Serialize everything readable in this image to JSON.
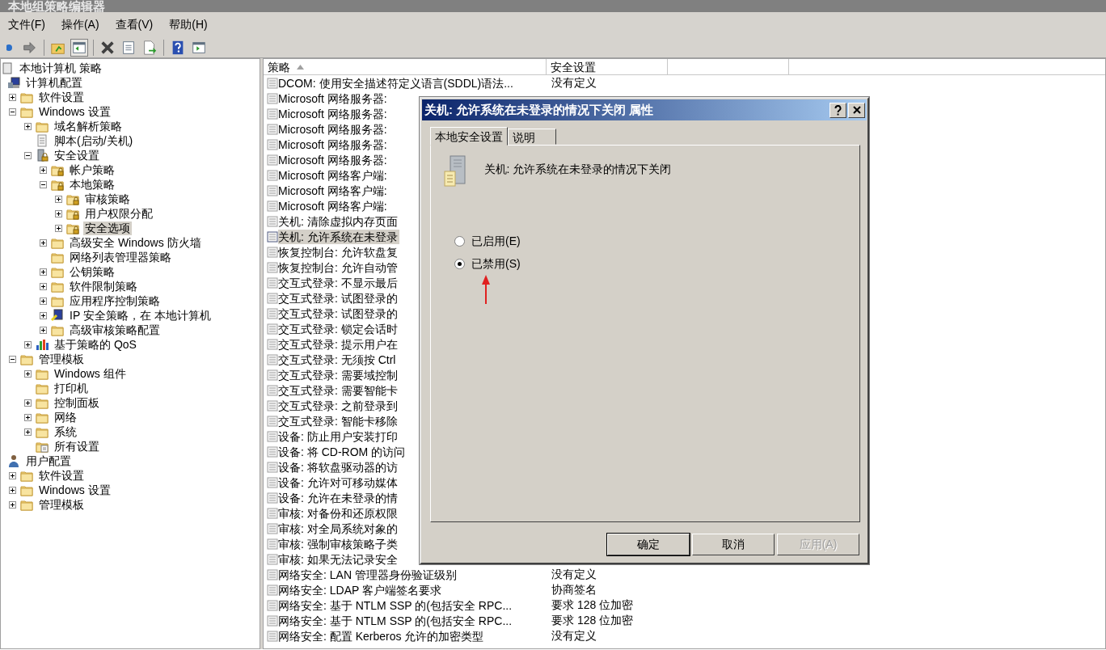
{
  "window": {
    "title": "本地组策略编辑器"
  },
  "menu": [
    "文件(F)",
    "操作(A)",
    "查看(V)",
    "帮助(H)"
  ],
  "toolbar": [
    {
      "kind": "back",
      "pressed": false
    },
    {
      "kind": "forward",
      "pressed": false
    },
    {
      "kind": "sep"
    },
    {
      "kind": "up",
      "pressed": false
    },
    {
      "kind": "tree",
      "pressed": true
    },
    {
      "kind": "sep"
    },
    {
      "kind": "delete",
      "pressed": false
    },
    {
      "kind": "properties",
      "pressed": false
    },
    {
      "kind": "export",
      "pressed": false
    },
    {
      "kind": "sep"
    },
    {
      "kind": "help",
      "pressed": false
    },
    {
      "kind": "pane",
      "pressed": false
    }
  ],
  "tree": [
    {
      "label": "本地计算机 策略",
      "kind": "policy",
      "selected": false,
      "children": [
        {
          "label": "计算机配置",
          "kind": "computer",
          "selected": false,
          "children": [
            {
              "label": "软件设置",
              "kind": "folder",
              "expanded": false,
              "selected": false
            },
            {
              "label": "Windows 设置",
              "kind": "folder",
              "expanded": true,
              "selected": false,
              "children": [
                {
                  "label": "域名解析策略",
                  "kind": "folder",
                  "expanded": false,
                  "selected": false
                },
                {
                  "label": "脚本(启动/关机)",
                  "kind": "script",
                  "selected": false
                },
                {
                  "label": "安全设置",
                  "kind": "server",
                  "expanded": true,
                  "selected": false,
                  "children": [
                    {
                      "label": "帐户策略",
                      "kind": "lockfolder",
                      "expanded": false,
                      "selected": false
                    },
                    {
                      "label": "本地策略",
                      "kind": "lockfolder",
                      "expanded": true,
                      "selected": false,
                      "children": [
                        {
                          "label": "审核策略",
                          "kind": "lockfolder",
                          "expanded": false,
                          "selected": false
                        },
                        {
                          "label": "用户权限分配",
                          "kind": "lockfolder",
                          "expanded": false,
                          "selected": false
                        },
                        {
                          "label": "安全选项",
                          "kind": "lockfolder",
                          "expanded": false,
                          "selected": true
                        }
                      ]
                    },
                    {
                      "label": "高级安全 Windows 防火墙",
                      "kind": "folder",
                      "expanded": false,
                      "selected": false
                    },
                    {
                      "label": "网络列表管理器策略",
                      "kind": "folder",
                      "selected": false
                    },
                    {
                      "label": "公钥策略",
                      "kind": "folder",
                      "expanded": false,
                      "selected": false
                    },
                    {
                      "label": "软件限制策略",
                      "kind": "folder",
                      "expanded": false,
                      "selected": false
                    },
                    {
                      "label": "应用程序控制策略",
                      "kind": "folder",
                      "expanded": false,
                      "selected": false
                    },
                    {
                      "label": "IP 安全策略，在 本地计算机",
                      "kind": "ipsec",
                      "expanded": false,
                      "selected": false
                    },
                    {
                      "label": "高级审核策略配置",
                      "kind": "folder",
                      "expanded": false,
                      "selected": false
                    }
                  ]
                },
                {
                  "label": "基于策略的 QoS",
                  "kind": "chart",
                  "expanded": false,
                  "selected": false
                }
              ]
            },
            {
              "label": "管理模板",
              "kind": "folder",
              "expanded": true,
              "selected": false,
              "children": [
                {
                  "label": "Windows 组件",
                  "kind": "folder",
                  "expanded": false,
                  "selected": false
                },
                {
                  "label": "打印机",
                  "kind": "folder",
                  "selected": false
                },
                {
                  "label": "控制面板",
                  "kind": "folder",
                  "expanded": false,
                  "selected": false
                },
                {
                  "label": "网络",
                  "kind": "folder",
                  "expanded": false,
                  "selected": false
                },
                {
                  "label": "系统",
                  "kind": "folder",
                  "expanded": false,
                  "selected": false
                },
                {
                  "label": "所有设置",
                  "kind": "settings",
                  "selected": false
                }
              ]
            }
          ]
        },
        {
          "label": "用户配置",
          "kind": "user",
          "selected": false,
          "children": [
            {
              "label": "软件设置",
              "kind": "folder",
              "expanded": false,
              "selected": false
            },
            {
              "label": "Windows 设置",
              "kind": "folder",
              "expanded": false,
              "selected": false
            },
            {
              "label": "管理模板",
              "kind": "folder",
              "expanded": false,
              "selected": false
            }
          ]
        }
      ]
    }
  ],
  "table": {
    "columns": [
      {
        "label": "策略",
        "sorted": true
      },
      {
        "label": "安全设置",
        "sorted": false
      }
    ],
    "rows": [
      {
        "name": "DCOM: 使用安全描述符定义语言(SDDL)语法...",
        "setting": "没有定义",
        "selected": false
      },
      {
        "name": "Microsoft 网络服务器:",
        "selected": false
      },
      {
        "name": "Microsoft 网络服务器:",
        "selected": false
      },
      {
        "name": "Microsoft 网络服务器:",
        "selected": false
      },
      {
        "name": "Microsoft 网络服务器:",
        "selected": false
      },
      {
        "name": "Microsoft 网络服务器:",
        "selected": false
      },
      {
        "name": "Microsoft 网络客户端:",
        "selected": false
      },
      {
        "name": "Microsoft 网络客户端:",
        "selected": false
      },
      {
        "name": "Microsoft 网络客户端:",
        "selected": false
      },
      {
        "name": "关机: 清除虚拟内存页面",
        "selected": false
      },
      {
        "name": "关机: 允许系统在未登录",
        "selected": true
      },
      {
        "name": "恢复控制台: 允许软盘复",
        "selected": false
      },
      {
        "name": "恢复控制台: 允许自动管",
        "selected": false
      },
      {
        "name": "交互式登录: 不显示最后",
        "selected": false
      },
      {
        "name": "交互式登录: 试图登录的",
        "selected": false
      },
      {
        "name": "交互式登录: 试图登录的",
        "selected": false
      },
      {
        "name": "交互式登录: 锁定会话时",
        "selected": false
      },
      {
        "name": "交互式登录: 提示用户在",
        "selected": false
      },
      {
        "name": "交互式登录: 无须按 Ctrl",
        "selected": false
      },
      {
        "name": "交互式登录: 需要域控制",
        "selected": false
      },
      {
        "name": "交互式登录: 需要智能卡",
        "selected": false
      },
      {
        "name": "交互式登录: 之前登录到",
        "selected": false
      },
      {
        "name": "交互式登录: 智能卡移除",
        "selected": false
      },
      {
        "name": "设备: 防止用户安装打印",
        "selected": false
      },
      {
        "name": "设备: 将 CD-ROM 的访问",
        "selected": false
      },
      {
        "name": "设备: 将软盘驱动器的访",
        "selected": false
      },
      {
        "name": "设备: 允许对可移动媒体",
        "selected": false
      },
      {
        "name": "设备: 允许在未登录的情",
        "selected": false
      },
      {
        "name": "审核: 对备份和还原权限",
        "selected": false
      },
      {
        "name": "审核: 对全局系统对象的",
        "selected": false
      },
      {
        "name": "审核: 强制审核策略子类",
        "selected": false
      },
      {
        "name": "审核: 如果无法记录安全",
        "selected": false
      },
      {
        "name": "网络安全: LAN 管理器身份验证级别",
        "setting": "没有定义",
        "selected": false
      },
      {
        "name": "网络安全: LDAP 客户端签名要求",
        "setting": "协商签名",
        "selected": false
      },
      {
        "name": "网络安全: 基于 NTLM SSP 的(包括安全 RPC...",
        "setting": "要求 128 位加密",
        "selected": false
      },
      {
        "name": "网络安全: 基于 NTLM SSP 的(包括安全 RPC...",
        "setting": "要求 128 位加密",
        "selected": false
      },
      {
        "name": "网络安全: 配置 Kerberos 允许的加密类型",
        "setting": "没有定义",
        "selected": false
      }
    ]
  },
  "dialog": {
    "title": "关机: 允许系统在未登录的情况下关闭 属性",
    "tabs": [
      {
        "label": "本地安全设置",
        "selected": true
      },
      {
        "label": "说明",
        "selected": false
      }
    ],
    "policy": "关机: 允许系统在未登录的情况下关闭",
    "options": [
      {
        "label": "已启用(E)",
        "selected": false
      },
      {
        "label": "已禁用(S)",
        "selected": true
      }
    ],
    "buttons": [
      {
        "label": "确定",
        "default": true,
        "disabled": false
      },
      {
        "label": "取消",
        "default": false,
        "disabled": false
      },
      {
        "label": "应用(A)",
        "default": false,
        "disabled": true
      }
    ]
  }
}
